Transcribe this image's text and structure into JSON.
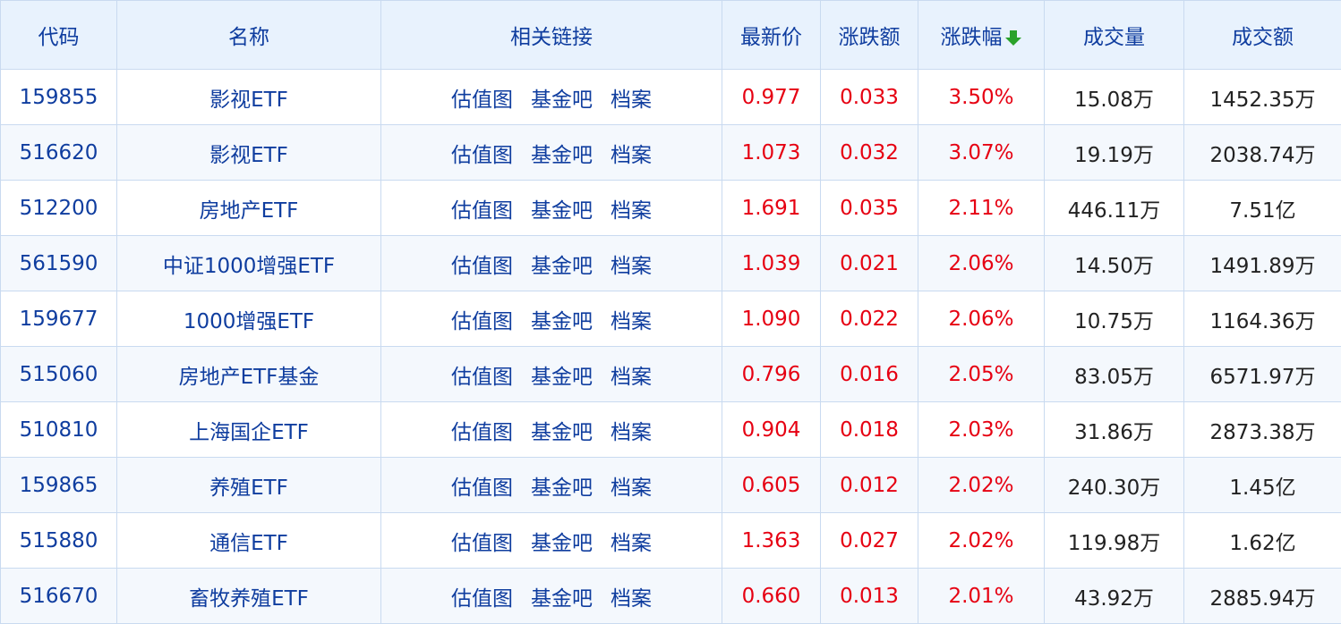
{
  "colors": {
    "header_bg": "#e8f2fd",
    "header_text": "#0f3d9f",
    "link": "#0f3d9f",
    "rise": "#e60012",
    "sort_arrow": "#2aa22a",
    "border": "#c9daf0"
  },
  "header": {
    "code": "代码",
    "name": "名称",
    "links": "相关链接",
    "price": "最新价",
    "change": "涨跌额",
    "change_pct": "涨跌幅",
    "sort_icon": "arrow-down-icon",
    "volume": "成交量",
    "turnover": "成交额"
  },
  "rows": [
    {
      "code": "159855",
      "name": "影视ETF",
      "links": [
        "估值图",
        "基金吧",
        "档案"
      ],
      "price": "0.977",
      "change": "0.033",
      "change_pct": "3.50%",
      "volume": "15.08万",
      "turnover": "1452.35万"
    },
    {
      "code": "516620",
      "name": "影视ETF",
      "links": [
        "估值图",
        "基金吧",
        "档案"
      ],
      "price": "1.073",
      "change": "0.032",
      "change_pct": "3.07%",
      "volume": "19.19万",
      "turnover": "2038.74万"
    },
    {
      "code": "512200",
      "name": "房地产ETF",
      "links": [
        "估值图",
        "基金吧",
        "档案"
      ],
      "price": "1.691",
      "change": "0.035",
      "change_pct": "2.11%",
      "volume": "446.11万",
      "turnover": "7.51亿"
    },
    {
      "code": "561590",
      "name": "中证1000增强ETF",
      "links": [
        "估值图",
        "基金吧",
        "档案"
      ],
      "price": "1.039",
      "change": "0.021",
      "change_pct": "2.06%",
      "volume": "14.50万",
      "turnover": "1491.89万"
    },
    {
      "code": "159677",
      "name": "1000增强ETF",
      "links": [
        "估值图",
        "基金吧",
        "档案"
      ],
      "price": "1.090",
      "change": "0.022",
      "change_pct": "2.06%",
      "volume": "10.75万",
      "turnover": "1164.36万"
    },
    {
      "code": "515060",
      "name": "房地产ETF基金",
      "links": [
        "估值图",
        "基金吧",
        "档案"
      ],
      "price": "0.796",
      "change": "0.016",
      "change_pct": "2.05%",
      "volume": "83.05万",
      "turnover": "6571.97万"
    },
    {
      "code": "510810",
      "name": "上海国企ETF",
      "links": [
        "估值图",
        "基金吧",
        "档案"
      ],
      "price": "0.904",
      "change": "0.018",
      "change_pct": "2.03%",
      "volume": "31.86万",
      "turnover": "2873.38万"
    },
    {
      "code": "159865",
      "name": "养殖ETF",
      "links": [
        "估值图",
        "基金吧",
        "档案"
      ],
      "price": "0.605",
      "change": "0.012",
      "change_pct": "2.02%",
      "volume": "240.30万",
      "turnover": "1.45亿"
    },
    {
      "code": "515880",
      "name": "通信ETF",
      "links": [
        "估值图",
        "基金吧",
        "档案"
      ],
      "price": "1.363",
      "change": "0.027",
      "change_pct": "2.02%",
      "volume": "119.98万",
      "turnover": "1.62亿"
    },
    {
      "code": "516670",
      "name": "畜牧养殖ETF",
      "links": [
        "估值图",
        "基金吧",
        "档案"
      ],
      "price": "0.660",
      "change": "0.013",
      "change_pct": "2.01%",
      "volume": "43.92万",
      "turnover": "2885.94万"
    }
  ]
}
